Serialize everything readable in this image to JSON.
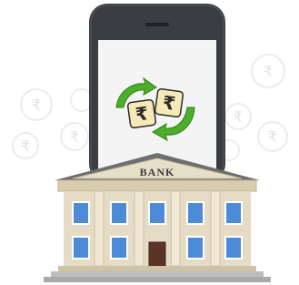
{
  "bank": {
    "sign": "BANK"
  },
  "exchange": {
    "symbol_left": "₹",
    "symbol_right": "₹",
    "arrow_color": "#4caf2a",
    "arrow_color_dark": "#2e7d14"
  },
  "background": {
    "coin_symbol": "₹"
  },
  "colors": {
    "phone_frame": "#3a3d42",
    "screen": "#f4f4f4",
    "building_wall": "#e6dcc6",
    "roof": "#6e6e6e",
    "window": "#4d8bd8",
    "door": "#5a3526",
    "steps": "#bdbdbd"
  }
}
